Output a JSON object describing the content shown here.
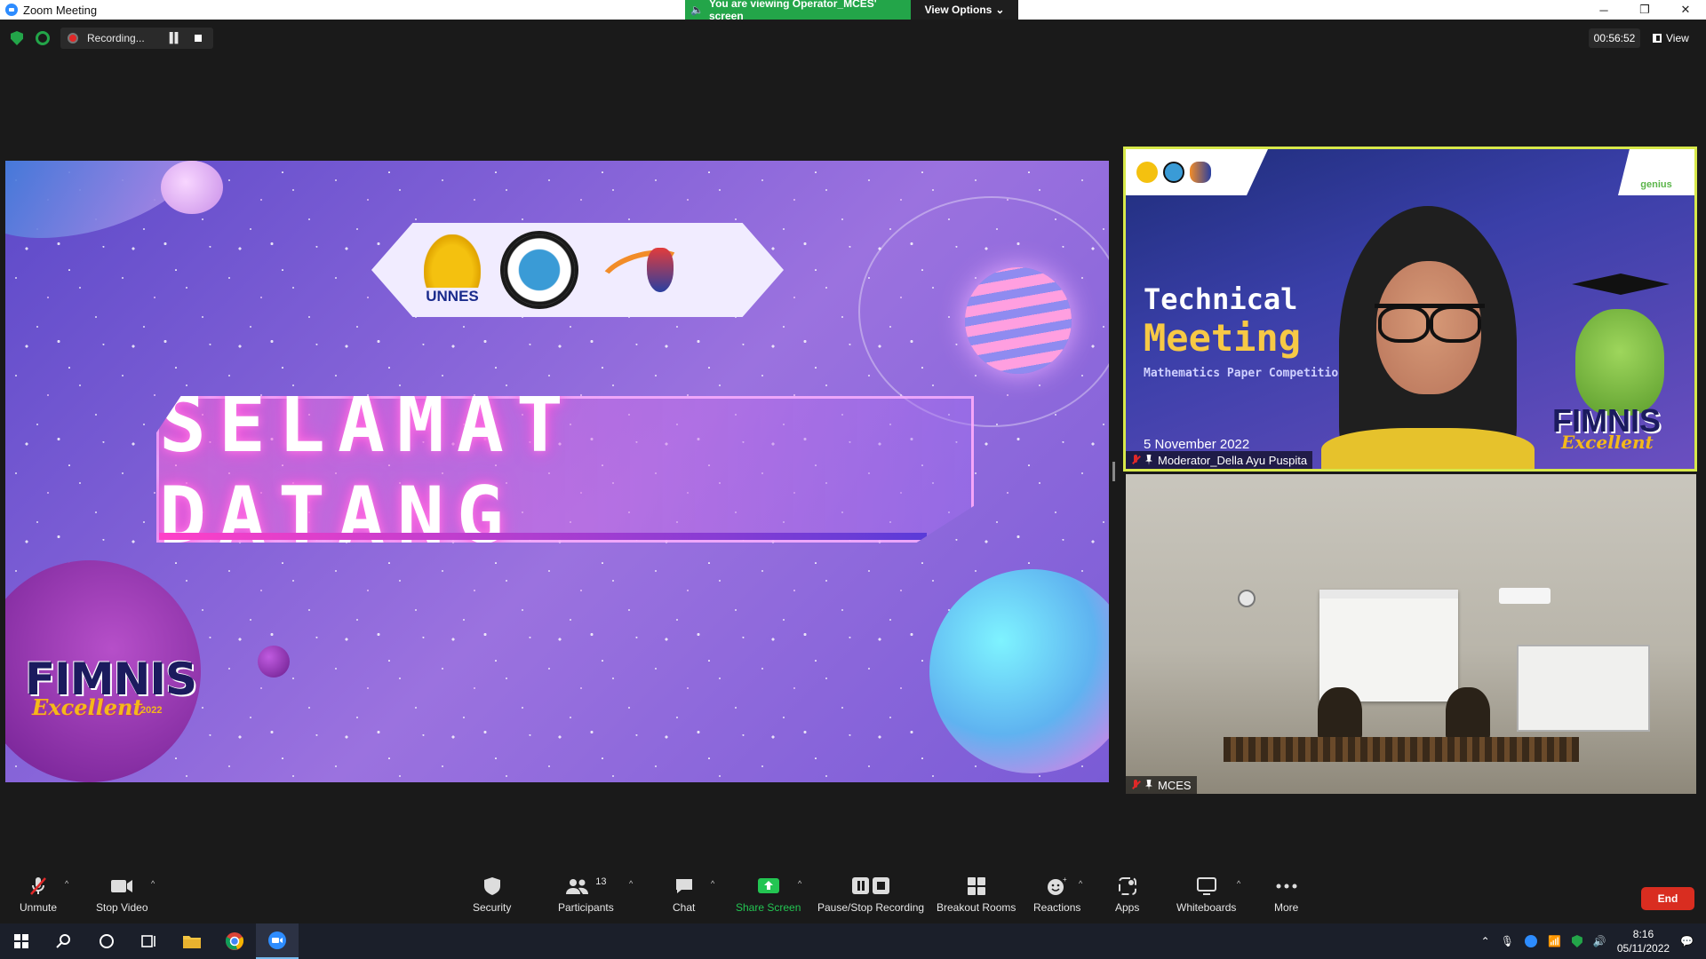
{
  "window": {
    "title": "Zoom Meeting",
    "viewing_banner": "You are viewing Operator_MCES' screen",
    "view_options": "View Options"
  },
  "topbar": {
    "recording_label": "Recording...",
    "timer": "00:56:52",
    "view_label": "View"
  },
  "share": {
    "welcome_text": "SELAMAT DATANG",
    "unnes_text": "UNNES",
    "fimnis_text": "FIMNIS",
    "fimnis_script": "Excellent",
    "fimnis_year": "2022"
  },
  "participants": [
    {
      "name": "Moderator_Della Ayu Puspita",
      "title_line1": "Technical",
      "title_line2": "Meeting",
      "subtitle": "Mathematics Paper Competition",
      "date": "5 November 2022",
      "corner_brand": "genius",
      "mascot_text": "FIMNIS",
      "mascot_script": "Excellent"
    },
    {
      "name": "MCES"
    }
  ],
  "toolbar": {
    "unmute": "Unmute",
    "stop_video": "Stop Video",
    "security": "Security",
    "participants": "Participants",
    "participant_count": "13",
    "chat": "Chat",
    "share_screen": "Share Screen",
    "pause_stop_recording": "Pause/Stop Recording",
    "breakout_rooms": "Breakout Rooms",
    "reactions": "Reactions",
    "apps": "Apps",
    "whiteboards": "Whiteboards",
    "more": "More",
    "end": "End"
  },
  "taskbar": {
    "time": "8:16",
    "date": "05/11/2022"
  },
  "colors": {
    "zoom_blue": "#2d8cff",
    "banner_green": "#23a549",
    "end_red": "#d92d20",
    "active_speaker": "#d7e84a"
  }
}
